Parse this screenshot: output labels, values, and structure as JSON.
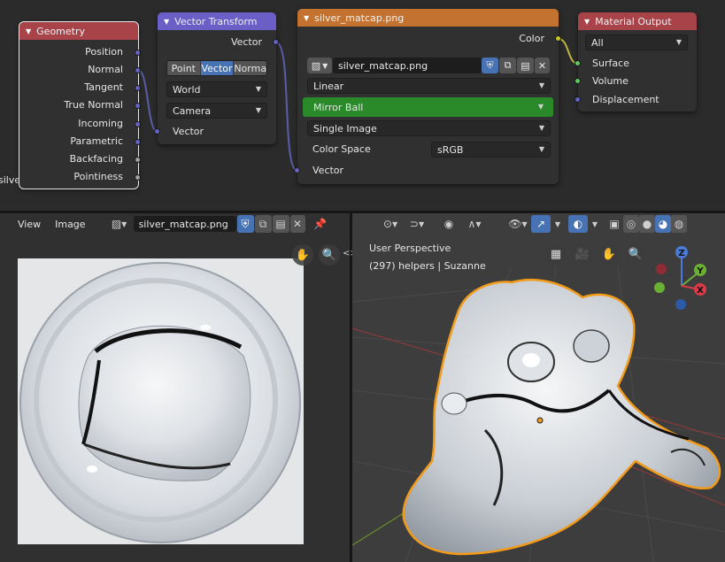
{
  "node_editor": {
    "side_label": "silver",
    "geometry": {
      "title": "Geometry",
      "outputs": [
        "Position",
        "Normal",
        "Tangent",
        "True Normal",
        "Incoming",
        "Parametric",
        "Backfacing",
        "Pointiness"
      ]
    },
    "vector_transform": {
      "title": "Vector Transform",
      "output": "Vector",
      "type_options": [
        "Point",
        "Vector",
        "Norma"
      ],
      "active_type": "Vector",
      "convert_from": "World",
      "convert_to": "Camera",
      "input": "Vector"
    },
    "image_texture": {
      "title": "silver_matcap.png",
      "output": "Color",
      "image_name": "silver_matcap.png",
      "interpolation": "Linear",
      "projection": "Mirror Ball",
      "source": "Single Image",
      "color_space_label": "Color Space",
      "color_space": "sRGB",
      "input": "Vector"
    },
    "material_output": {
      "title": "Material Output",
      "target": "All",
      "inputs": [
        "Surface",
        "Volume",
        "Displacement"
      ]
    }
  },
  "image_editor": {
    "menus": [
      "View",
      "Image"
    ],
    "image_name": "silver_matcap.png"
  },
  "viewport": {
    "view_name": "User Perspective",
    "object_info": "(297) helpers | Suzanne",
    "gizmo_axes": [
      "Z",
      "Y",
      "X"
    ]
  },
  "colors": {
    "geometry_header": "#a8434a",
    "vector_header": "#6b5ec7",
    "texture_header": "#c4722f",
    "output_header": "#a8434a",
    "selection_outline": "#f29a1a",
    "accent_blue": "#4772b3",
    "mirror_ball_green": "#2a8a2a"
  }
}
